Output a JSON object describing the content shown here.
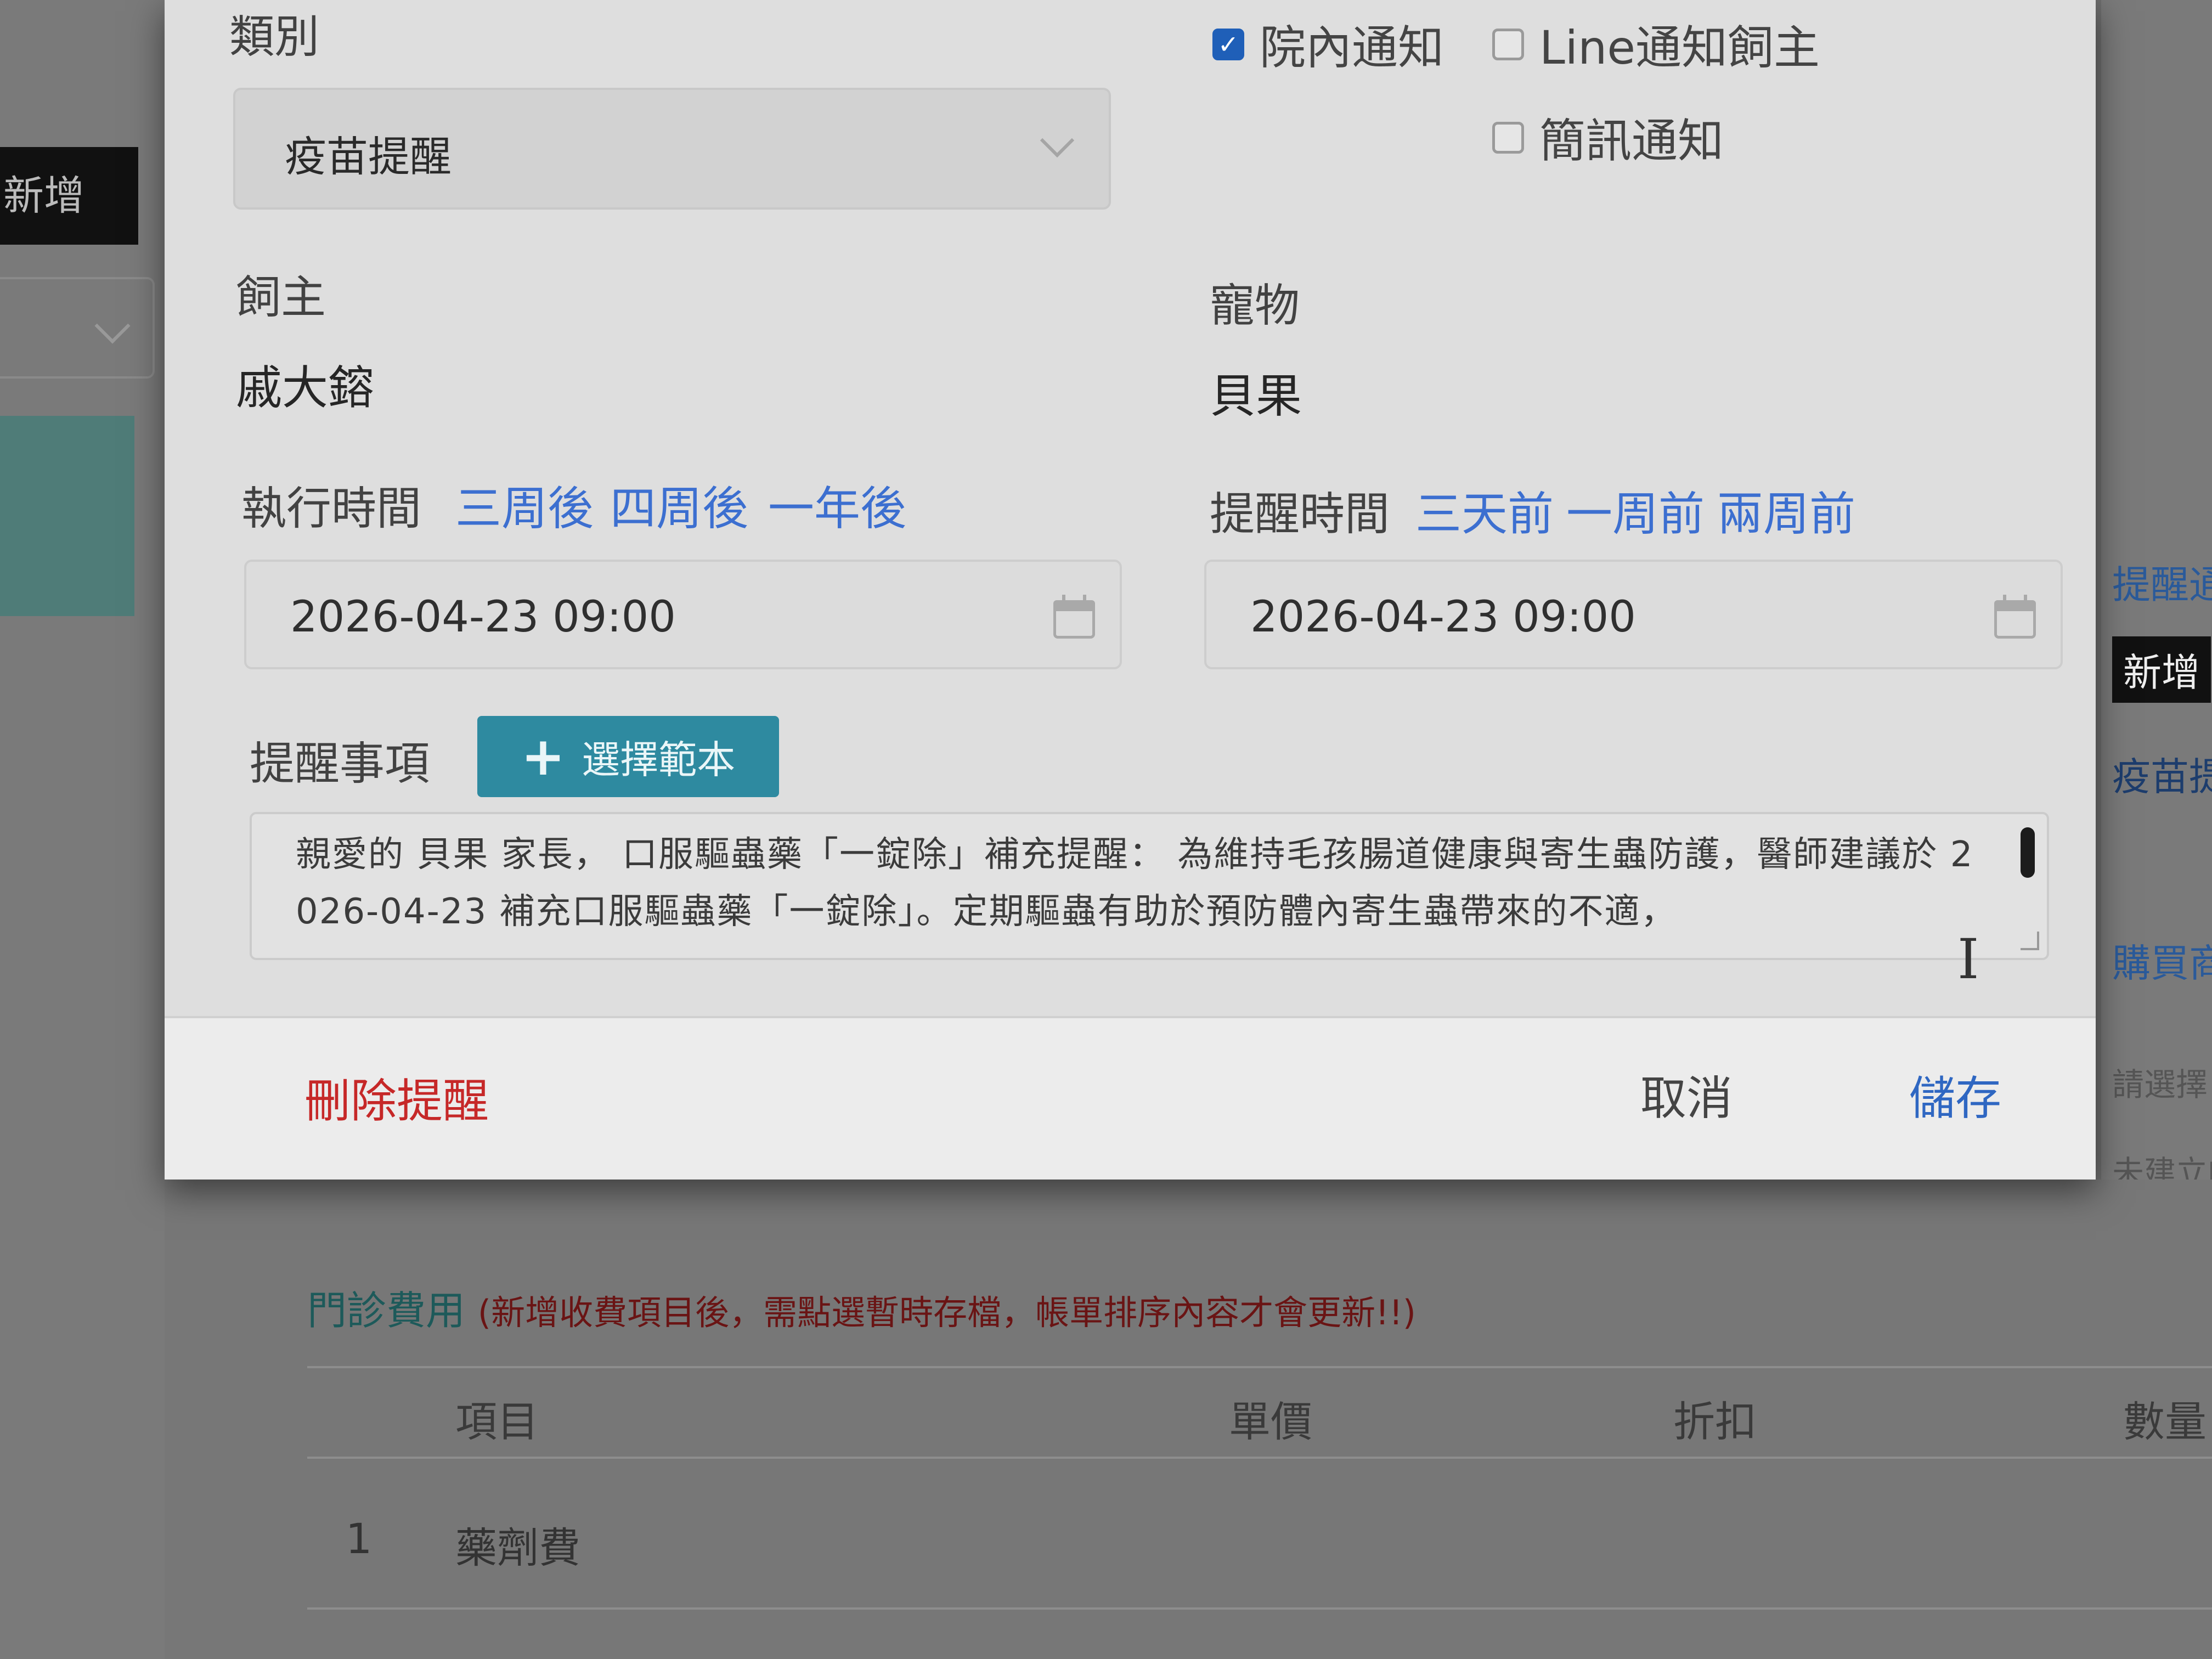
{
  "background": {
    "left_button": "新增",
    "right_fragments": [
      "提醒通知",
      "新增",
      "疫苗提醒",
      "購買商品",
      "請選擇",
      "未建立的"
    ],
    "fees": {
      "title": "門診費用",
      "note": "(新增收費項目後，需點選暫時存檔，帳單排序內容才會更新!!)"
    },
    "table": {
      "headers": [
        "項目",
        "單價",
        "折扣",
        "數量"
      ],
      "rows": [
        {
          "no": "1",
          "item": "藥劑費"
        }
      ]
    }
  },
  "modal": {
    "category_label": "類別",
    "category_value": "疫苗提醒",
    "notify": {
      "in_hospital": {
        "label": "院內通知",
        "checked": true
      },
      "line_owner": {
        "label": "Line通知飼主",
        "checked": false
      },
      "sms": {
        "label": "簡訊通知",
        "checked": false
      }
    },
    "owner_label": "飼主",
    "owner_value": "戚大鎔",
    "pet_label": "寵物",
    "pet_value": "貝果",
    "exec_time": {
      "label": "執行時間",
      "quick": [
        "三周後",
        "四周後",
        "一年後"
      ],
      "value": "2026-04-23 09:00"
    },
    "remind_time": {
      "label": "提醒時間",
      "quick": [
        "三天前",
        "一周前",
        "兩周前"
      ],
      "value": "2026-04-23 09:00"
    },
    "notes_label": "提醒事項",
    "template_button": "選擇範本",
    "notes_text": "親愛的 貝果 家長，  口服驅蟲藥「一錠除」補充提醒：  為維持毛孩腸道健康與寄生蟲防護，醫師建議於 2026-04-23 補充口服驅蟲藥「一錠除」。定期驅蟲有助於預防體內寄生蟲帶來的不適，",
    "delete_button": "刪除提醒",
    "cancel_button": "取消",
    "save_button": "儲存"
  },
  "colors": {
    "link_blue": "#3c6fd0",
    "danger_red": "#c62828",
    "template_button": "#2e8aa0",
    "checkbox_checked": "#1f5fb8"
  }
}
